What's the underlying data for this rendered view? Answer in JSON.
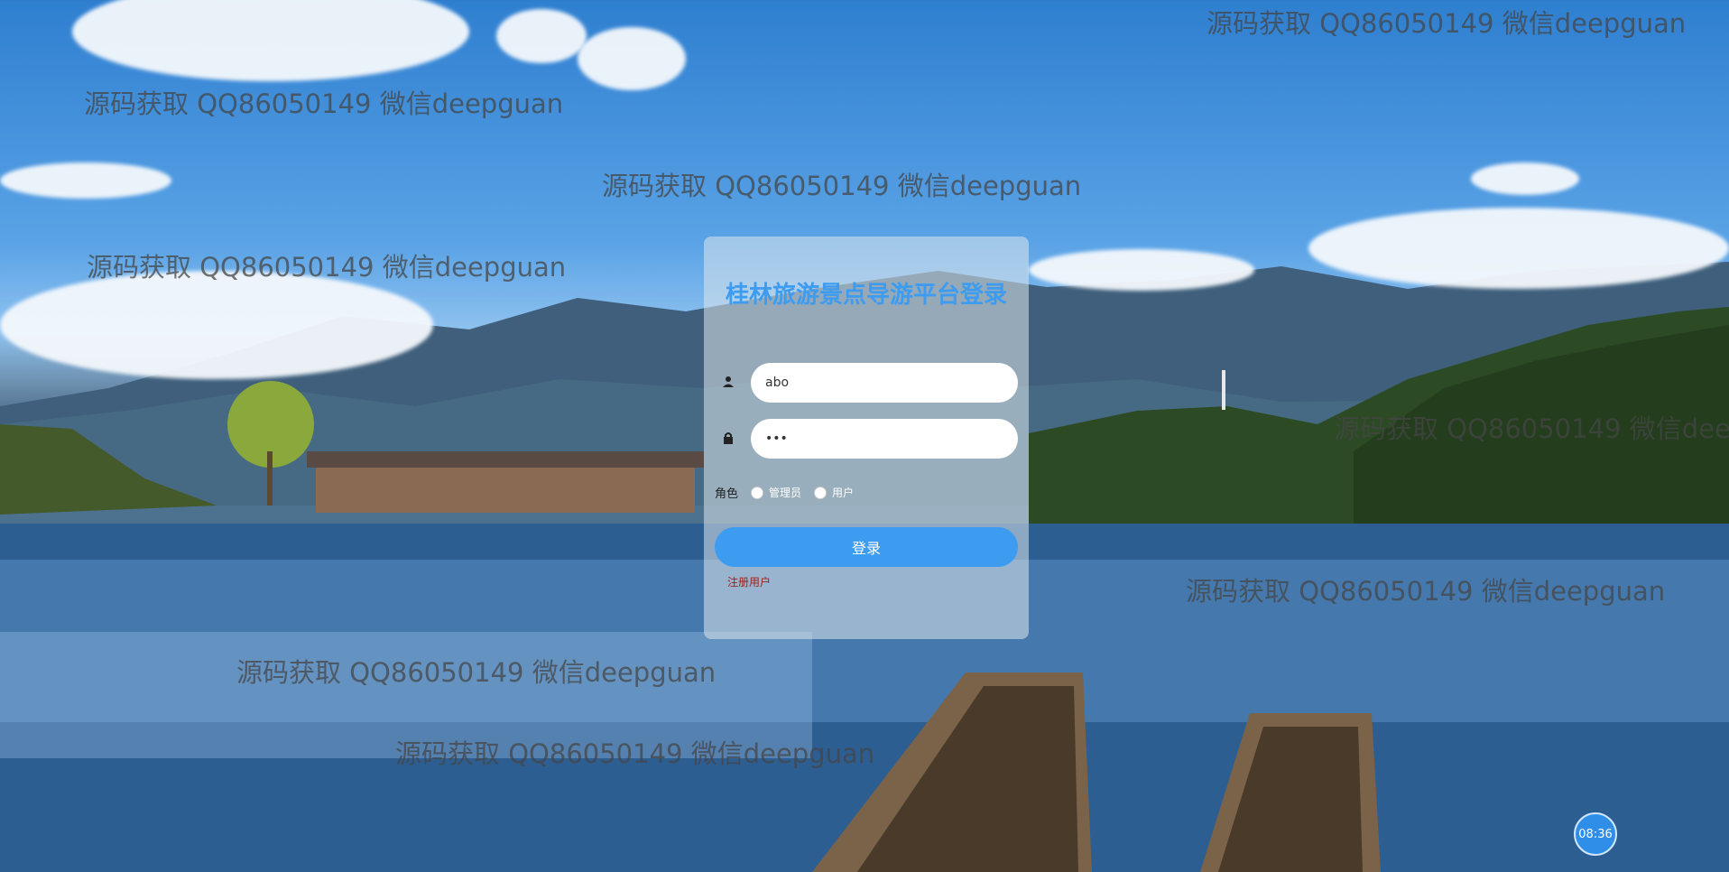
{
  "watermark_text": "源码获取 QQ86050149 微信deepguan",
  "login": {
    "title": "桂林旅游景点导游平台登录",
    "username_value": "abo",
    "password_value": "•••",
    "role_label": "角色",
    "role_options": [
      "管理员",
      "用户"
    ],
    "submit_label": "登录",
    "register_label": "注册用户"
  },
  "clock": {
    "time": "08:36"
  },
  "colors": {
    "accent": "#3d9cf0",
    "register_link": "#a0201a"
  },
  "icons": [
    "user-icon",
    "lock-icon"
  ]
}
